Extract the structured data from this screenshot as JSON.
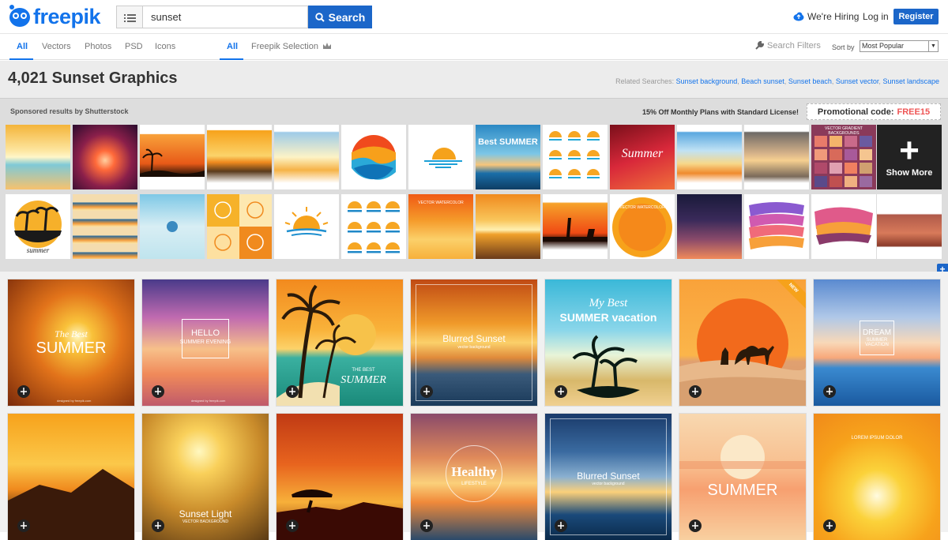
{
  "header": {
    "logo_text": "freepik",
    "search_value": "sunset",
    "search_button": "Search",
    "hiring": "We're Hiring",
    "login": "Log in",
    "register": "Register"
  },
  "tabs": {
    "type_tabs": [
      "All",
      "Vectors",
      "Photos",
      "PSD",
      "Icons"
    ],
    "source_tabs": [
      "All",
      "Freepik Selection"
    ],
    "search_filters": "Search Filters",
    "sort_by": "Sort by",
    "sort_value": "Most Popular"
  },
  "title_bar": {
    "title": "4,021 Sunset Graphics",
    "related_label": "Related Searches:",
    "related_links": [
      "Sunset background",
      "Beach sunset",
      "Sunset beach",
      "Sunset vector",
      "Sunset landscape"
    ]
  },
  "sponsored": {
    "label": "Sponsored results by Shutterstock",
    "offer": "15% Off Monthly Plans with Standard License!",
    "promo_label": "Promotional code:",
    "promo_code": "FREE15",
    "show_more": "Show More",
    "tile_texts": {
      "best_summer": "Best SUMMER",
      "summer": "summer",
      "summer_script": "Summer",
      "watercolor": "VECTOR WATERCOLOR",
      "gradient": "VECTOR GRADIENT BACKGROUNDS"
    }
  },
  "results": {
    "row1": [
      {
        "title": "The Best",
        "sub": "SUMMER"
      },
      {
        "title": "HELLO",
        "sub": "SUMMER EVENING"
      },
      {
        "title": "THE BEST",
        "sub": "SUMMER"
      },
      {
        "title": "Blurred Sunset",
        "sub": "vector background"
      },
      {
        "title": "My Best",
        "sub": "SUMMER vacation"
      },
      {
        "title": "NEW",
        "sub": ""
      },
      {
        "title": "DREAM",
        "sub": "SUMMER VACATION"
      }
    ],
    "row2": [
      {
        "title": "",
        "sub": ""
      },
      {
        "title": "Sunset Light",
        "sub": "VECTOR BACKGROUND"
      },
      {
        "title": "",
        "sub": ""
      },
      {
        "title": "Healthy",
        "sub": "LIFESTYLE"
      },
      {
        "title": "Blurred Sunset",
        "sub": "vector background"
      },
      {
        "title": "SUMMER",
        "sub": ""
      },
      {
        "title": "LOREM IPSUM DOLOR",
        "sub": ""
      }
    ],
    "watermark": "designed by freepik.com"
  },
  "colors": {
    "brand": "#1273eb",
    "button": "#1b66c9",
    "promo_code": "#e55555"
  }
}
